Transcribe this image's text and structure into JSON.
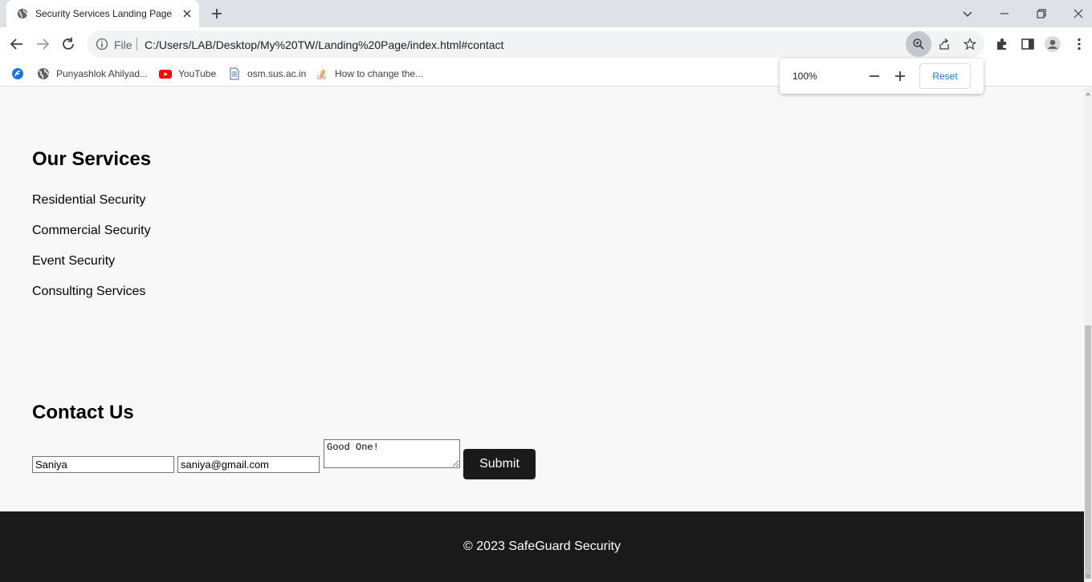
{
  "browser": {
    "tab_title": "Security Services Landing Page",
    "file_label": "File",
    "url": "C:/Users/LAB/Desktop/My%20TW/Landing%20Page/index.html#contact",
    "bookmarks": [
      {
        "label": "",
        "icon": "google-services-icon"
      },
      {
        "label": "Punyashlok Ahilyad...",
        "icon": "globe-icon"
      },
      {
        "label": "YouTube",
        "icon": "youtube-icon"
      },
      {
        "label": "osm.sus.ac.in",
        "icon": "document-icon"
      },
      {
        "label": "How to change the...",
        "icon": "stackoverflow-icon"
      }
    ],
    "zoom_popup": {
      "level": "100%",
      "reset_label": "Reset"
    }
  },
  "page": {
    "services": {
      "title": "Our Services",
      "items": [
        "Residential Security",
        "Commercial Security",
        "Event Security",
        "Consulting Services"
      ]
    },
    "contact": {
      "title": "Contact Us",
      "name_value": "Saniya",
      "email_value": "saniya@gmail.com",
      "message_value": "Good One!",
      "submit_label": "Submit"
    },
    "footer_text": "© 2023 SafeGuard Security"
  },
  "colors": {
    "page_bg": "#f8f8f8",
    "dark": "#1a1a1a",
    "accent": "#1a73e8"
  }
}
